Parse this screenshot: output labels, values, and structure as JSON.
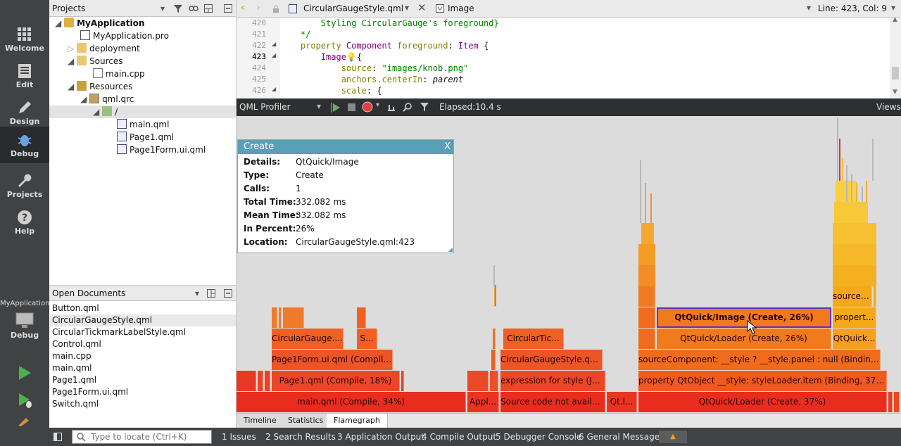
{
  "modes": [
    {
      "label": "Welcome",
      "icon": "grid-icon"
    },
    {
      "label": "Edit",
      "icon": "document-icon"
    },
    {
      "label": "Design",
      "icon": "pencil-icon"
    },
    {
      "label": "Debug",
      "icon": "bug-icon"
    },
    {
      "label": "Projects",
      "icon": "wrench-icon"
    },
    {
      "label": "Help",
      "icon": "help-icon"
    }
  ],
  "kit": {
    "project": "MyApplication",
    "config": "Debug"
  },
  "projects": {
    "title": "Projects",
    "tree": [
      {
        "label": "MyApplication"
      },
      {
        "label": "MyApplication.pro"
      },
      {
        "label": "deployment"
      },
      {
        "label": "Sources"
      },
      {
        "label": "main.cpp"
      },
      {
        "label": "Resources"
      },
      {
        "label": "qml.qrc"
      },
      {
        "label": "/"
      },
      {
        "label": "main.qml"
      },
      {
        "label": "Page1.qml"
      },
      {
        "label": "Page1Form.ui.qml"
      }
    ]
  },
  "open_documents": {
    "title": "Open Documents",
    "items": [
      "Button.qml",
      "CircularGaugeStyle.qml",
      "CircularTickmarkLabelStyle.qml",
      "Control.qml",
      "main.cpp",
      "main.qml",
      "Page1.qml",
      "Page1Form.ui.qml",
      "Switch.qml"
    ]
  },
  "editor": {
    "file": "CircularGaugeStyle.qml",
    "symbol": "Image",
    "position": "Line: 423, Col: 9",
    "lines": [
      {
        "num": "420",
        "text": "        Styling CircularGauge's foreground}"
      },
      {
        "num": "421",
        "text": "    */"
      },
      {
        "num": "422",
        "text": "    property Component foreground: Item {"
      },
      {
        "num": "423",
        "text": "        Image {"
      },
      {
        "num": "424",
        "text": "            source: \"images/knob.png\""
      },
      {
        "num": "425",
        "text": "            anchors.centerIn: parent"
      },
      {
        "num": "426",
        "text": "            scale: {"
      }
    ]
  },
  "profiler": {
    "selector": "QML Profiler",
    "elapsed_label": "Elapsed:",
    "elapsed_value": "10.4 s",
    "views": "Views",
    "tabs": [
      "Timeline",
      "Statistics",
      "Flamegraph"
    ],
    "active_tab": "Flamegraph"
  },
  "tooltip": {
    "title": "Create",
    "close": "X",
    "rows": [
      {
        "k": "Details:",
        "v": "QtQuick/Image"
      },
      {
        "k": "Type:",
        "v": "Create"
      },
      {
        "k": "Calls:",
        "v": "1"
      },
      {
        "k": "Total Time:",
        "v": "332.082 ms"
      },
      {
        "k": "Mean Time:",
        "v": "332.082 ms"
      },
      {
        "k": "In Percent:",
        "v": "26%"
      },
      {
        "k": "Location:",
        "v": "CircularGaugeStyle.qml:423"
      }
    ]
  },
  "flame_labels": {
    "r1a": "main.qml (Compile, 34%)",
    "r1b": "Appl...",
    "r1c": "Source code not availab...",
    "r1d": "Qt.l...",
    "r1e": "QtQuick/Loader (Create, 37%)",
    "r2a": "Page1.qml (Compile, 18%)",
    "r2b": "expression for style (Jav...",
    "r2c": "property QtObject __style: styleLoader.item (Binding, 37%)",
    "r3a": "Page1Form.ui.qml (Compile,...",
    "r3b": "CircularGaugeStyle.qml...",
    "r3c": "sourceComponent: __style ? __style.panel : null (Binding, 3...",
    "r4a": "CircularGauge....",
    "r4b": "S...",
    "r4c": "CircularTic...",
    "r4d": "QtQuick/Loader (Create, 26%)",
    "r4e": "QtQuick...",
    "r5a": "QtQuick/Image (Create, 26%)",
    "r5b": "propert...",
    "r6a": "sourceC..."
  },
  "status": {
    "locate_placeholder": "Type to locate (Ctrl+K)",
    "panes": [
      "1  Issues",
      "2  Search Results",
      "3  Application Output",
      "4  Compile Output",
      "5  Debugger Console",
      "6  General Messages"
    ]
  }
}
